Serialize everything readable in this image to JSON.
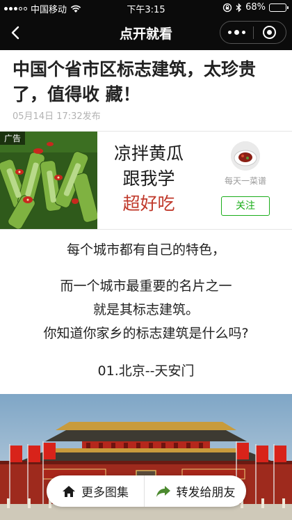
{
  "status_bar": {
    "carrier": "中国移动",
    "time": "下午3:15",
    "battery": "68%",
    "battery_level": 0.68,
    "icons": [
      "signal-icon",
      "wifi-icon",
      "lock-rotation-icon",
      "bluetooth-icon",
      "battery-icon"
    ]
  },
  "nav": {
    "title": "点开就看",
    "back_icon": "chevron-left-icon",
    "more_icon": "more-dots-icon",
    "close_icon": "close-circle-icon"
  },
  "article": {
    "title": "中国个省市区标志建筑，太珍贵了，值得收 藏！",
    "meta": "05月14日 17:32发布"
  },
  "ad": {
    "tag": "广告",
    "line1": "凉拌黄瓜",
    "line2": "跟我学",
    "line3": "超好吃",
    "account": "每天一菜谱",
    "follow": "关注"
  },
  "content": {
    "p1": "每个城市都有自己的特色，",
    "p2_line1": "而一个城市最重要的名片之一",
    "p2_line2": "就是其标志建筑。",
    "p2_line3": "你知道你家乡的标志建筑是什么吗?",
    "p3": "01.北京--天安门"
  },
  "float_bar": {
    "gallery": "更多图集",
    "share": "转发给朋友",
    "gallery_icon": "home-icon",
    "share_icon": "share-arrow-icon"
  },
  "colors": {
    "nav_bg": "#0b0b0b",
    "wechat_green": "#1aad19",
    "accent_red": "#c0392b"
  }
}
